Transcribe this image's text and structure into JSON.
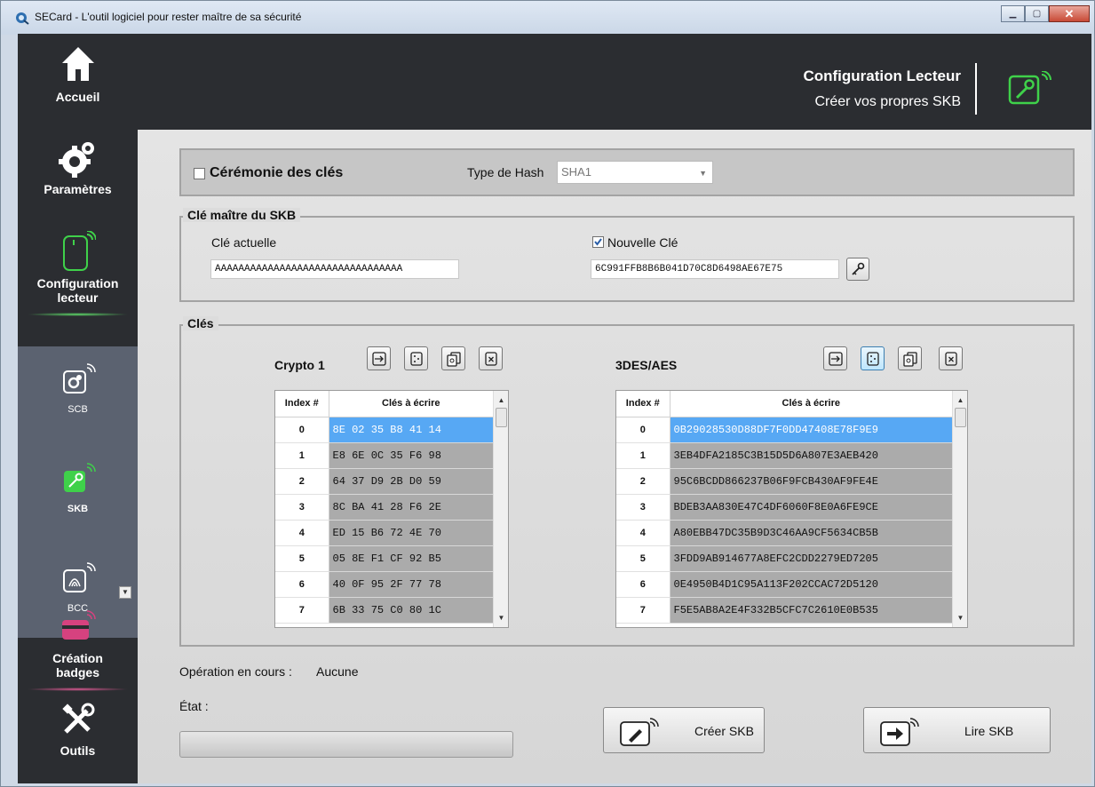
{
  "window": {
    "title": "SECard - L'outil logiciel pour rester maître de sa sécurité"
  },
  "sidebar": {
    "items": [
      {
        "label": "Accueil"
      },
      {
        "label": "Paramètres"
      },
      {
        "label_line1": "Configuration",
        "label_line2": "lecteur"
      },
      {
        "label_line1": "Création",
        "label_line2": "badges"
      },
      {
        "label": "Outils"
      }
    ],
    "subitems": [
      "SCB",
      "SKB",
      "BCC"
    ]
  },
  "header": {
    "title": "Configuration Lecteur",
    "subtitle": "Créer vos propres SKB"
  },
  "ceremony": {
    "label": "Cérémonie des clés",
    "checked": false,
    "hash_label": "Type de Hash",
    "hash_value": "SHA1"
  },
  "master": {
    "legend": "Clé maître du SKB",
    "current_label": "Clé actuelle",
    "current_value": "AAAAAAAAAAAAAAAAAAAAAAAAAAAAAAAA",
    "new_label": "Nouvelle Clé",
    "new_checked": true,
    "new_value": "6C991FFB8B6B041D70C8D6498AE67E75"
  },
  "keys": {
    "legend": "Clés",
    "crypto1": {
      "title": "Crypto 1",
      "col_index": "Index #",
      "col_keys": "Clés à écrire",
      "rows": [
        {
          "i": "0",
          "v": "8E 02 35 B8 41 14"
        },
        {
          "i": "1",
          "v": "E8 6E 0C 35 F6 98"
        },
        {
          "i": "2",
          "v": "64 37 D9 2B D0 59"
        },
        {
          "i": "3",
          "v": "8C BA 41 28 F6 2E"
        },
        {
          "i": "4",
          "v": "ED 15 B6 72 4E 70"
        },
        {
          "i": "5",
          "v": "05 8E F1 CF 92 B5"
        },
        {
          "i": "6",
          "v": "40 0F 95 2F 77 78"
        },
        {
          "i": "7",
          "v": "6B 33 75 C0 80 1C"
        }
      ]
    },
    "des": {
      "title": "3DES/AES",
      "col_index": "Index #",
      "col_keys": "Clés à écrire",
      "rows": [
        {
          "i": "0",
          "v": "0B29028530D88DF7F0DD47408E78F9E9"
        },
        {
          "i": "1",
          "v": "3EB4DFA2185C3B15D5D6A807E3AEB420"
        },
        {
          "i": "2",
          "v": "95C6BCDD866237B06F9FCB430AF9FE4E"
        },
        {
          "i": "3",
          "v": "BDEB3AA830E47C4DF6060F8E0A6FE9CE"
        },
        {
          "i": "4",
          "v": "A80EBB47DC35B9D3C46AA9CF5634CB5B"
        },
        {
          "i": "5",
          "v": "3FDD9AB914677A8EFC2CDD2279ED7205"
        },
        {
          "i": "6",
          "v": "0E4950B4D1C95A113F202CCAC72D5120"
        },
        {
          "i": "7",
          "v": "F5E5AB8A2E4F332B5CFC7C2610E0B535"
        }
      ]
    }
  },
  "status": {
    "op_label": "Opération en cours :",
    "op_value": "Aucune",
    "state_label": "État :"
  },
  "actions": {
    "create": "Créer SKB",
    "read": "Lire SKB"
  },
  "colors": {
    "dark": "#2b2d31",
    "subnav": "#5b6270",
    "accent_green": "#3fd14a",
    "accent_pink": "#d6427f",
    "selection": "#57a8f4"
  }
}
